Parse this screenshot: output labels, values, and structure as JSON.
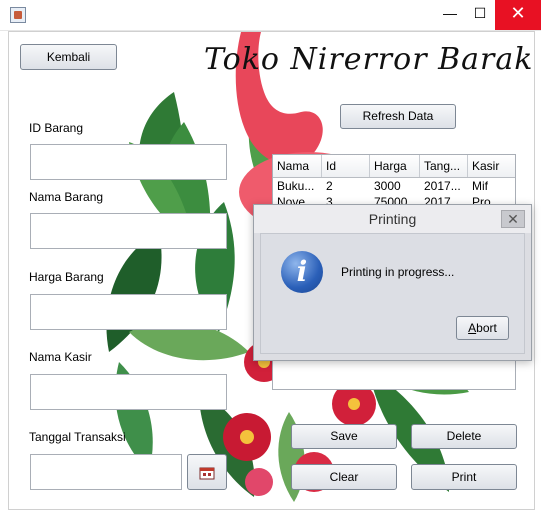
{
  "window": {
    "minimize_glyph": "—",
    "maximize_glyph": "☐",
    "close_glyph": "✕"
  },
  "heading": "Toko Nirerror Barakallah",
  "buttons": {
    "back": "Kembali",
    "refresh": "Refresh Data",
    "save": "Save",
    "delete": "Delete",
    "clear": "Clear",
    "print": "Print"
  },
  "form": {
    "id_label": "ID Barang",
    "id_value": "",
    "name_label": "Nama Barang",
    "name_value": "",
    "price_label": "Harga Barang",
    "price_value": "",
    "cashier_label": "Nama Kasir",
    "cashier_value": "",
    "date_label": "Tanggal Transaksi",
    "date_value": ""
  },
  "table": {
    "columns": [
      "Nama",
      "Id",
      "Harga",
      "Tang...",
      "Kasir"
    ],
    "rows": [
      [
        "Buku...",
        "2",
        "3000",
        "2017...",
        "Mif"
      ],
      [
        "Nove...",
        "3",
        "75000",
        "2017...",
        "Pro..."
      ]
    ]
  },
  "dialog": {
    "title": "Printing",
    "close_glyph": "✕",
    "message": "Printing in progress...",
    "abort": "Abort",
    "abort_mnemonic": "A",
    "abort_rest": "bort",
    "icon_glyph": "i"
  },
  "colors": {
    "flamingo": "#e8475a",
    "leaf": "#2f7a35",
    "hibiscus": "#d1203a",
    "close_red": "#e81123"
  }
}
